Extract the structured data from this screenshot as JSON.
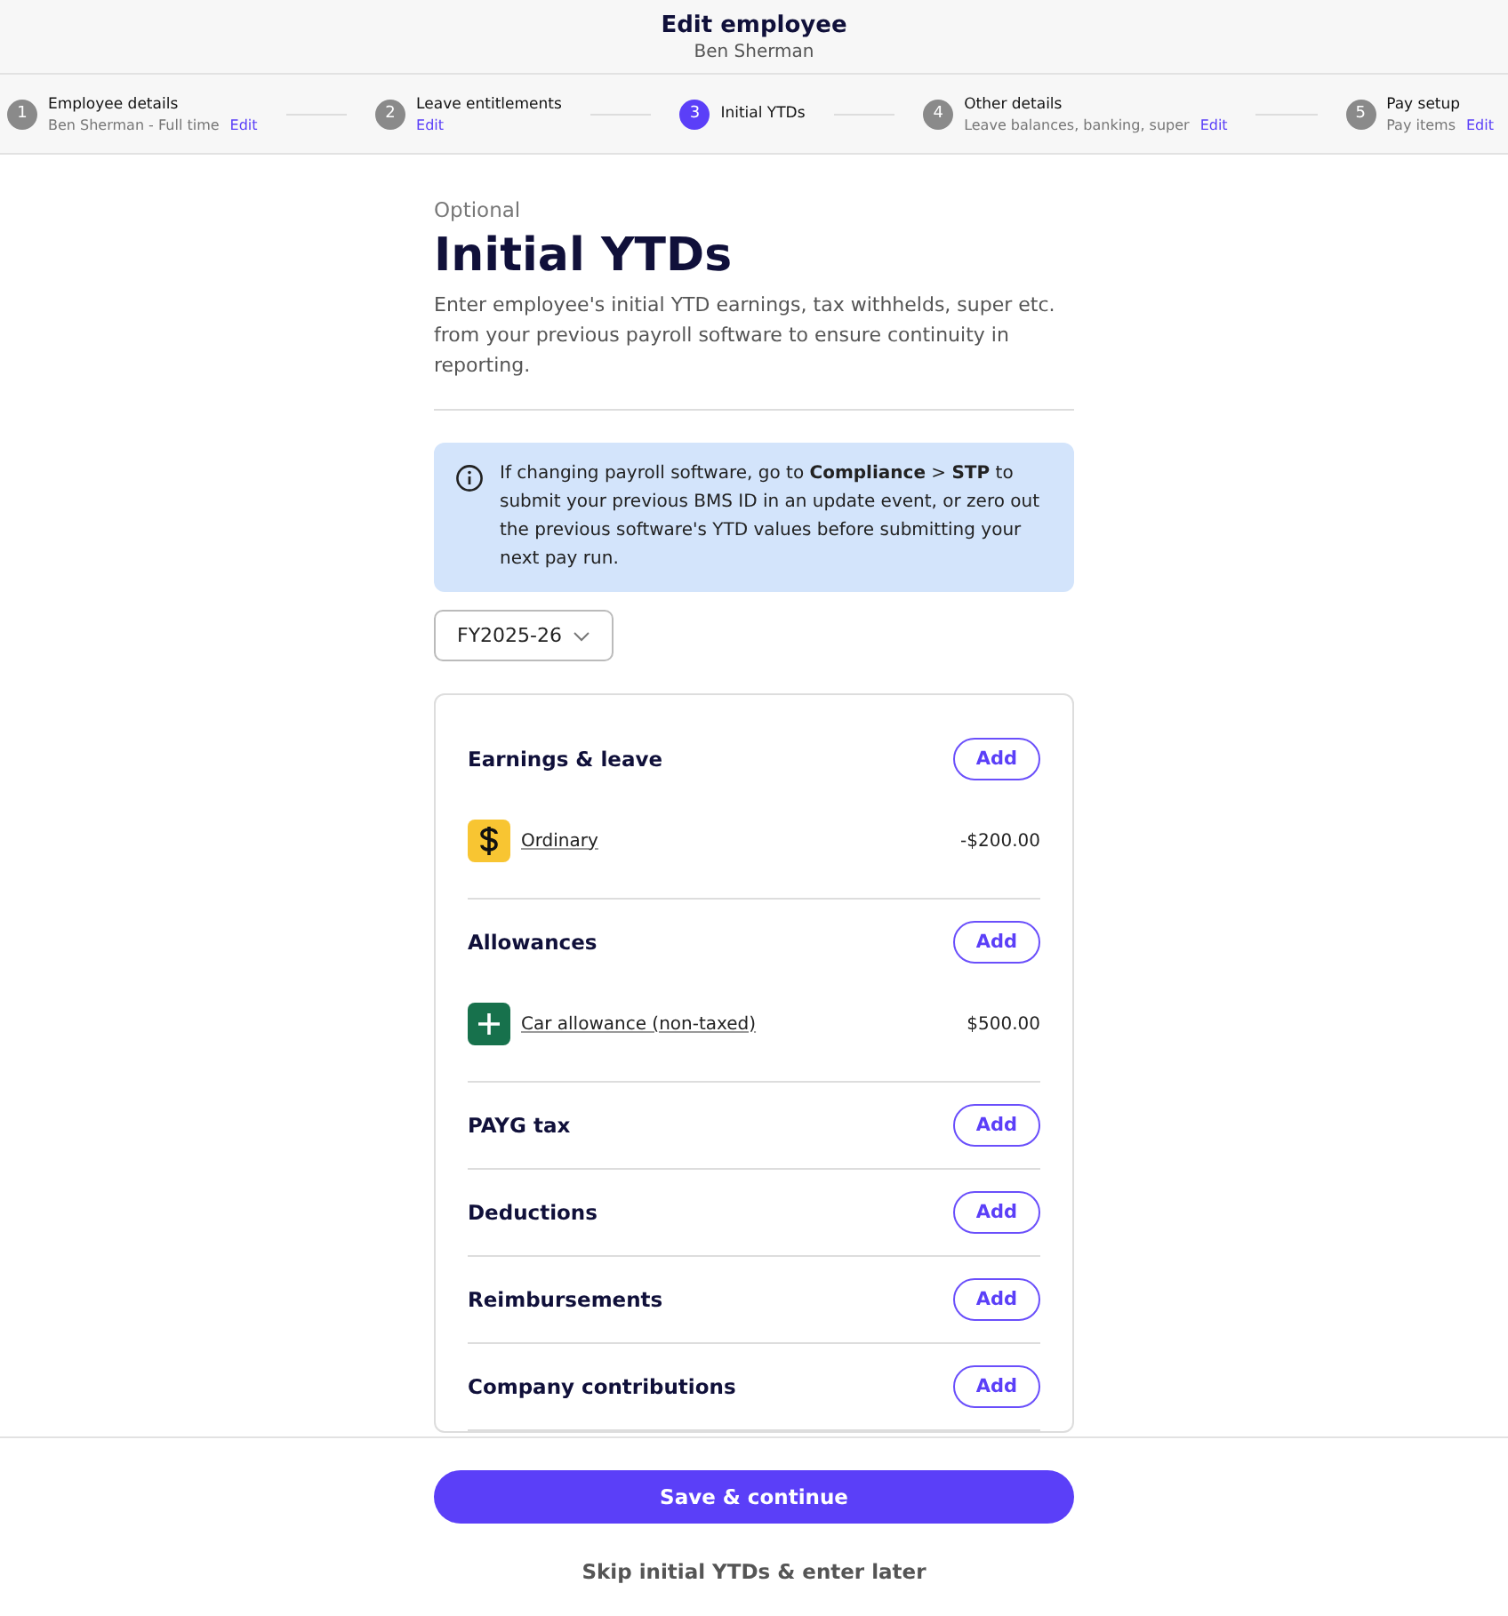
{
  "header": {
    "title": "Edit employee",
    "subtitle": "Ben Sherman"
  },
  "steps": [
    {
      "number": "1",
      "title": "Employee details",
      "subtitle": "Ben Sherman - Full time",
      "edit": "Edit",
      "selected": false
    },
    {
      "number": "2",
      "title": "Leave entitlements",
      "edit": "Edit",
      "selected": false
    },
    {
      "number": "3",
      "title": "Initial YTDs",
      "selected": true
    },
    {
      "number": "4",
      "title": "Other details",
      "subtitle": "Leave balances, banking, super",
      "edit": "Edit",
      "selected": false
    },
    {
      "number": "5",
      "title": "Pay setup",
      "subtitle": "Pay items",
      "edit": "Edit",
      "selected": false
    }
  ],
  "page": {
    "eyebrow": "Optional",
    "title": "Initial YTDs",
    "description": "Enter employee's initial YTD earnings, tax withhelds, super etc. from your previous payroll software to ensure continuity in reporting."
  },
  "alert": "If changing payroll software, go to **Compliance** > **STP** to submit your previous BMS ID in an update event, or zero out the previous software's YTD values before submitting your next pay run.",
  "year_select": "FY2025-26",
  "sections": [
    {
      "title": "Earnings & leave",
      "button": "Add",
      "items": [
        {
          "kind": "earning",
          "label": "Ordinary",
          "amount": "-$200.00"
        }
      ]
    },
    {
      "title": "Allowances",
      "button": "Add",
      "items": [
        {
          "kind": "allowance",
          "label": "Car allowance (non-taxed)",
          "amount": "$500.00"
        }
      ]
    },
    {
      "title": "PAYG tax",
      "button": "Add"
    },
    {
      "title": "Deductions",
      "button": "Add"
    },
    {
      "title": "Reimbursements",
      "button": "Add"
    },
    {
      "title": "Company contributions",
      "button": "Add"
    }
  ],
  "footer": {
    "primary": "Save & continue",
    "secondary": "Skip initial YTDs & enter later"
  }
}
